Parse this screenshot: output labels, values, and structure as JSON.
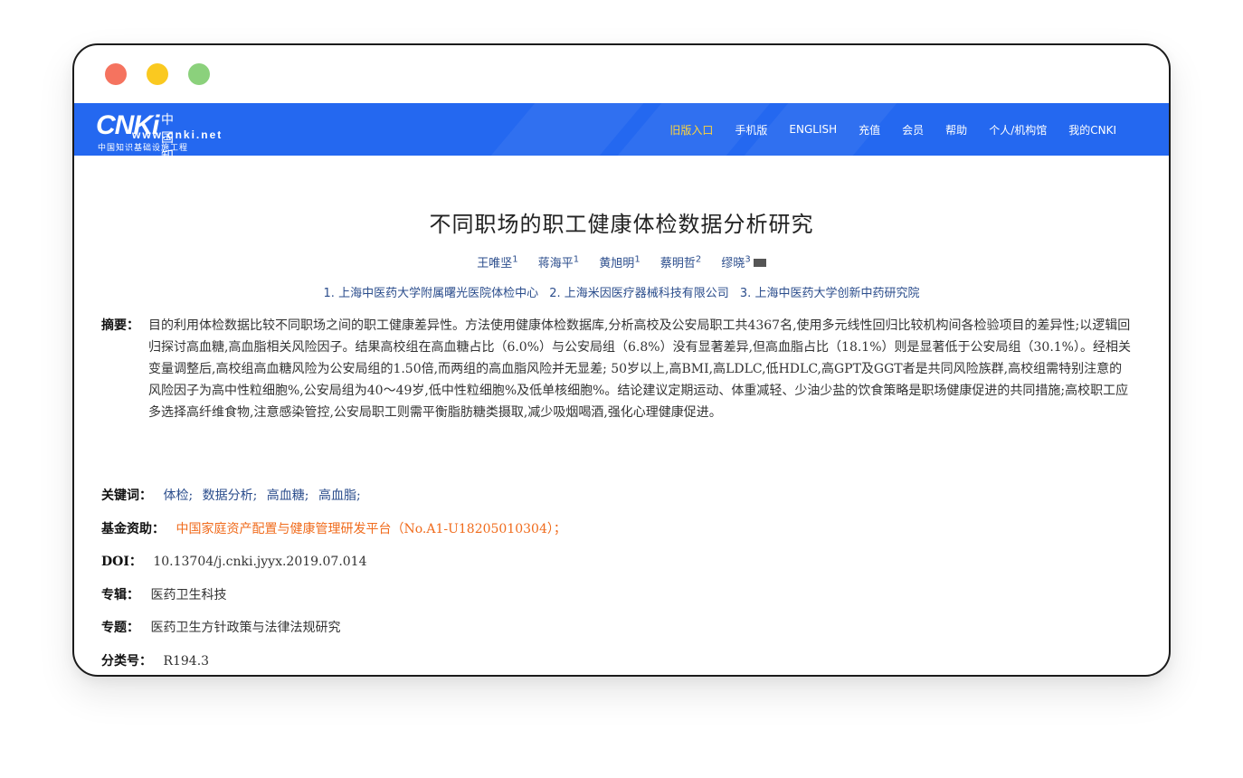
{
  "window": {
    "controls": [
      "close",
      "minimize",
      "zoom"
    ],
    "colors": {
      "close": "#f5735f",
      "minimize": "#fac920",
      "zoom": "#8bd17c"
    }
  },
  "header": {
    "logo": {
      "mark": "CNKi",
      "cn_name": "中国知网",
      "url": "www.cnki.net",
      "subtitle": "中国知识基础设施工程"
    },
    "nav": [
      {
        "label": "旧版入口",
        "highlight": true
      },
      {
        "label": "手机版",
        "highlight": false
      },
      {
        "label": "ENGLISH",
        "highlight": false
      },
      {
        "label": "充值",
        "highlight": false
      },
      {
        "label": "会员",
        "highlight": false
      },
      {
        "label": "帮助",
        "highlight": false
      },
      {
        "label": "个人/机构馆",
        "highlight": false
      },
      {
        "label": "我的CNKI",
        "highlight": false
      }
    ],
    "colors": {
      "bar": "#2468f0",
      "highlight": "#ffd43a"
    }
  },
  "article": {
    "title": "不同职场的职工健康体检数据分析研究",
    "authors": [
      {
        "name": "王唯坚",
        "sup": "1"
      },
      {
        "name": "蒋海平",
        "sup": "1"
      },
      {
        "name": "黄旭明",
        "sup": "1"
      },
      {
        "name": "蔡明哲",
        "sup": "2"
      },
      {
        "name": "缪晓",
        "sup": "3"
      }
    ],
    "affiliations": [
      "1. 上海中医药大学附属曙光医院体检中心",
      "2. 上海米因医疗器械科技有限公司",
      "3. 上海中医药大学创新中药研究院"
    ],
    "abstract_label": "摘要：",
    "abstract": "目的利用体检数据比较不同职场之间的职工健康差异性。方法使用健康体检数据库,分析高校及公安局职工共4367名,使用多元线性回归比较机构间各检验项目的差异性;以逻辑回归探讨高血糖,高血脂相关风险因子。结果高校组在高血糖占比（6.0%）与公安局组（6.8%）没有显著差异,但高血脂占比（18.1%）则是显著低于公安局组（30.1%）。经相关变量调整后,高校组高血糖风险为公安局组的1.50倍,而两组的高血脂风险并无显差; 50岁以上,高BMI,高LDLC,低HDLC,高GPT及GGT者是共同风险族群,高校组需特别注意的风险因子为高中性粒细胞%,公安局组为40～49岁,低中性粒细胞%及低单核细胞%。结论建议定期运动、体重减轻、少油少盐的饮食策略是职场健康促进的共同措施;高校职工应多选择高纤维食物,注意感染管控,公安局职工则需平衡脂肪糖类摄取,减少吸烟喝酒,强化心理健康促进。",
    "keywords_label": "关键词：",
    "keywords": [
      "体检;",
      "数据分析;",
      "高血糖;",
      "高血脂;"
    ],
    "fund_label": "基金资助：",
    "fund": "中国家庭资产配置与健康管理研发平台（No.A1-U18205010304）；",
    "doi_label": "DOI：",
    "doi": "10.13704/j.cnki.jyyx.2019.07.014",
    "album_label": "专辑：",
    "album": "医药卫生科技",
    "topic_label": "专题：",
    "topic": "医药卫生方针政策与法律法规研究",
    "class_label": "分类号：",
    "class": "R194.3",
    "colors": {
      "link": "#2b4d8c",
      "fund": "#f06b1c"
    }
  }
}
